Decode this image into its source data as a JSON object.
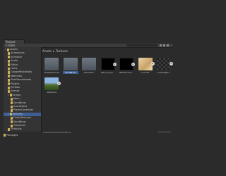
{
  "panel": {
    "tab_label": "Project"
  },
  "toolbar": {
    "add_label": "Create"
  },
  "sidebar": {
    "items": [
      {
        "label": "Assets",
        "indent": 0,
        "has_arrow": true
      },
      {
        "label": "Animations",
        "indent": 1
      },
      {
        "label": "Animator",
        "indent": 1
      },
      {
        "label": "Audio",
        "indent": 1
      },
      {
        "label": "Editor",
        "indent": 1
      },
      {
        "label": "Fonts",
        "indent": 1
      },
      {
        "label": "GoogleMobileAds",
        "indent": 1
      },
      {
        "label": "Materials",
        "indent": 1
      },
      {
        "label": "PixelVerseAssets",
        "indent": 1
      },
      {
        "label": "Plugins",
        "indent": 1
      },
      {
        "label": "Prefabs",
        "indent": 1
      },
      {
        "label": "Scenes",
        "indent": 1
      },
      {
        "label": "Scripts",
        "indent": 1,
        "has_arrow": true
      },
      {
        "label": "Menu",
        "indent": 2
      },
      {
        "label": "SandBrow",
        "indent": 2
      },
      {
        "label": "ScoreMana",
        "indent": 2
      },
      {
        "label": "PlayerController",
        "indent": 2
      },
      {
        "label": "Textures",
        "indent": 1,
        "has_arrow": true,
        "selected": true
      },
      {
        "label": "FireflyTextures",
        "indent": 2
      },
      {
        "label": "SandBrow",
        "indent": 2
      },
      {
        "label": "Transition",
        "indent": 2
      },
      {
        "label": "UnityAds",
        "indent": 1
      }
    ],
    "packages_label": "Packages"
  },
  "breadcrumb": {
    "root": "Assets",
    "separator": "▸",
    "current": "Textures"
  },
  "assets": [
    {
      "label": "FireflyTextures",
      "kind": "folder"
    },
    {
      "label": "SandBrow",
      "kind": "folder",
      "selected": true
    },
    {
      "label": "Transition",
      "kind": "folder"
    },
    {
      "label": "black_squa...",
      "kind": "black"
    },
    {
      "label": "BlackScree...",
      "kind": "black"
    },
    {
      "label": "icon512",
      "kind": "parch"
    },
    {
      "label": "LoadingBG...",
      "kind": "checker"
    },
    {
      "label": "UITexture",
      "kind": "blue"
    }
  ],
  "status": {
    "path": "Assets/Textures/SandBrow"
  },
  "colors": {
    "selection": "#3e5f96",
    "folder": "#cfaf5a",
    "background": "#2b2b2b"
  }
}
